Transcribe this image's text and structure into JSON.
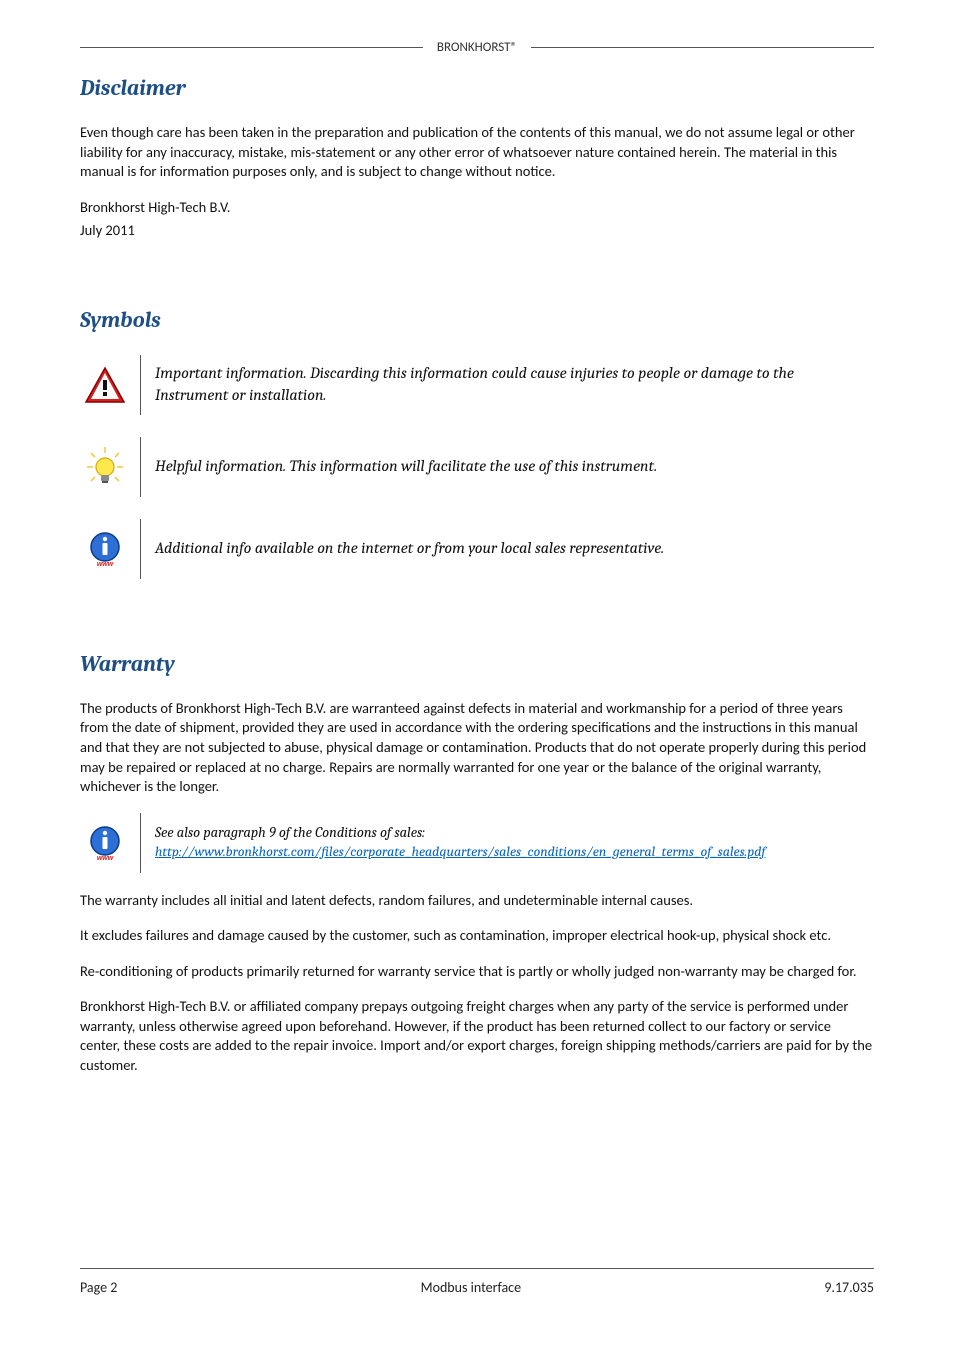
{
  "header": {
    "brand": "BRONKHORST®"
  },
  "sections": {
    "disclaimer": {
      "heading": "Disclaimer",
      "para1": "Even though care has been taken in the preparation and publication of the contents of this manual, we do not assume legal or other liability for any inaccuracy, mistake, mis-statement or any other error of whatsoever nature contained herein. The material in this manual is for information purposes only, and is subject to change without notice.",
      "company": "Bronkhorst High-Tech B.V.",
      "date": "July 2011"
    },
    "symbolsHeading": "Symbols",
    "symbols": [
      {
        "icon": "warning-icon",
        "line1": "Important information. Discarding this information could cause injuries to people or damage to the",
        "line2": "Instrument or installation."
      },
      {
        "icon": "lightbulb-icon",
        "line1": "Helpful information. This information will facilitate the use of this instrument.",
        "line2": ""
      },
      {
        "icon": "info-www-icon",
        "line1": "Additional info available on the internet or from your local sales representative.",
        "line2": ""
      }
    ],
    "warranty": {
      "heading": "Warranty",
      "para1": "The products of Bronkhorst High-Tech B.V. are warranteed against defects in material and workmanship for a period of three years from the date of shipment, provided they are used in accordance with the ordering specifications and the instructions in this manual and that they are not subjected to abuse, physical damage or contamination. Products that do not operate properly during this period may be repaired or replaced at no charge. Repairs are normally warranted for one year or the balance of the original warranty, whichever is the longer.",
      "note": {
        "lead": "See also paragraph 9 of the Conditions of sales:",
        "link": "http://www.bronkhorst.com/files/corporate_headquarters/sales_conditions/en_general_terms_of_sales.pdf"
      },
      "para2": "The warranty includes all initial and latent defects, random failures, and undeterminable internal causes.",
      "para3": "It excludes failures and damage caused by the customer, such as contamination, improper electrical hook-up, physical shock etc.",
      "para4": "Re-conditioning of products primarily returned for warranty service that is partly or wholly judged non-warranty may be charged for.",
      "para5": "Bronkhorst High-Tech B.V. or affiliated company prepays outgoing freight charges when any party of the service is performed under warranty, unless otherwise agreed upon beforehand. However, if the product has been returned collect to our factory or service center, these costs are added to the repair invoice. Import and/or export charges, foreign shipping methods/carriers are paid for by the customer."
    }
  },
  "footer": {
    "left": "Page 2",
    "center": "Modbus interface",
    "right": "9.17.035"
  }
}
